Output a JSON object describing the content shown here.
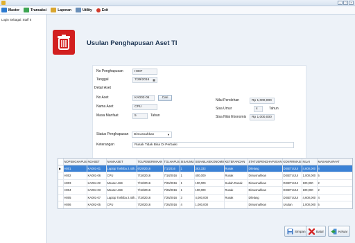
{
  "menu": {
    "items": [
      {
        "label": "Master",
        "icon": "master-icon"
      },
      {
        "label": "Transaksi",
        "icon": "transaksi-icon"
      },
      {
        "label": "Laporan",
        "icon": "laporan-icon"
      },
      {
        "label": "Utility",
        "icon": "utility-icon"
      },
      {
        "label": "Exit",
        "icon": "exit-icon"
      }
    ]
  },
  "window": {
    "min": "_",
    "max": "□",
    "close": "×"
  },
  "sidebar": {
    "login_text": "Login Sebagai: Staff It"
  },
  "header": {
    "title": "Usulan Penghapusan Aset TI"
  },
  "form": {
    "no_penghapusan_label": "No Penghapusan",
    "no_penghapusan_value": "H007",
    "tanggal_label": "Tanggal",
    "tanggal_value": "7/29/2016",
    "detail_label": "Detail Aset",
    "no_aset_label": "No Aset",
    "no_aset_value": "KA002-05",
    "cari_label": "Cari",
    "nama_aset_label": "Nama Aset",
    "nama_aset_value": "CPU",
    "masa_manfaat_label": "Masa Manfaat",
    "masa_manfaat_value": "5",
    "tahun_label": "Tahun",
    "nilai_perolehan_label": "Nilai Perolehan",
    "nilai_perolehan_value": "Rp  1,000,000",
    "sisa_umur_label": "Sisa Umur",
    "sisa_umur_value": "4",
    "tahun2_label": "Tahun",
    "sisa_nilai_label": "Sisa Nilai Ekonomis",
    "sisa_nilai_value": "Rp  1,000,000",
    "status_label": "Status Penghapusan",
    "status_value": "Dimusnahkan",
    "keterangan_label": "Keterangan",
    "keterangan_value": "Rusak Tidak Bisa Di Perbaiki"
  },
  "table": {
    "columns": [
      "NOPENGHAPUSAN",
      "NOASET",
      "NAMAASET",
      "TGLPENERIMAAN",
      "TGLHAPUS",
      "SISAUMUR",
      "SISANILAIEKONOMIS",
      "KETERANGAN",
      "STATUSPENGHAPUSAN",
      "KONFIRMASI",
      "NILAI",
      "MASAMANFAAT"
    ],
    "rows": [
      [
        "H001",
        "KA001-01",
        "Laptop Toshiba 2.40h...",
        "6/29/2016",
        "7/1/2016",
        "1",
        "383,333",
        "Rusak",
        "Dilelang",
        "DISETUJUI",
        "4,600,000",
        "4"
      ],
      [
        "H002",
        "KA001-06",
        "CPU",
        "7/18/2016",
        "7/18/2016",
        "1",
        "400,000",
        "Rusak",
        "Dimusnahkan",
        "DISETUJUI",
        "1,000,000",
        "5"
      ],
      [
        "H003",
        "KA004-02",
        "Mouse USB",
        "7/18/2016",
        "7/26/2016",
        "1",
        "100,000",
        "Sudah Rusak",
        "Dimusnahkan",
        "DISETUJUI",
        "100,000",
        "2"
      ],
      [
        "H004",
        "KA004-03",
        "Mouse USB",
        "7/18/2016",
        "7/26/2016",
        "1",
        "100,000",
        "Rusak",
        "Dimusnahkan",
        "DISETUJUI",
        "100,000",
        "2"
      ],
      [
        "H005",
        "KA001-07",
        "Laptop Toshiba 2.40h...",
        "7/18/2016",
        "7/26/2016",
        "3",
        "4,000,000",
        "Rusak",
        "Dilelang",
        "DISETUJUI",
        "4,600,000",
        "4"
      ],
      [
        "H006",
        "KA002-05",
        "CPU",
        "7/28/2016",
        "7/26/2016",
        "4",
        "1,000,000",
        "",
        "Dimusnahkan",
        "Usulan",
        "1,000,000",
        "5"
      ]
    ]
  },
  "actions": {
    "simpan": "Simpan",
    "batal": "Batal",
    "keluar": "Keluar"
  }
}
